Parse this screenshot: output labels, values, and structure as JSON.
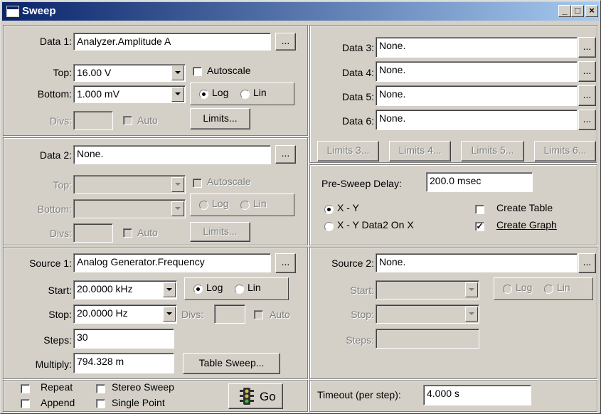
{
  "window": {
    "title": "Sweep",
    "min": "_",
    "max": "□",
    "close": "×"
  },
  "data1": {
    "label": "Data 1:",
    "value": "Analyzer.Amplitude A",
    "browse": "...",
    "top_label": "Top:",
    "top_value": "16.00   V",
    "autoscale": "Autoscale",
    "bottom_label": "Bottom:",
    "bottom_value": "1.000   mV",
    "log": "Log",
    "lin": "Lin",
    "divs_label": "Divs:",
    "auto": "Auto",
    "limits": "Limits..."
  },
  "data2": {
    "label": "Data 2:",
    "value": "None.",
    "browse": "...",
    "top_label": "Top:",
    "autoscale": "Autoscale",
    "bottom_label": "Bottom:",
    "log": "Log",
    "lin": "Lin",
    "divs_label": "Divs:",
    "auto": "Auto",
    "limits": "Limits..."
  },
  "data_right": [
    {
      "label": "Data 3:",
      "value": "None.",
      "browse": "..."
    },
    {
      "label": "Data 4:",
      "value": "None.",
      "browse": "..."
    },
    {
      "label": "Data 5:",
      "value": "None.",
      "browse": "..."
    },
    {
      "label": "Data 6:",
      "value": "None.",
      "browse": "..."
    }
  ],
  "limits_buttons": [
    "Limits 3...",
    "Limits 4...",
    "Limits 5...",
    "Limits 6..."
  ],
  "presweep": {
    "label": "Pre-Sweep Delay:",
    "value": "200.0   msec",
    "xy": "X - Y",
    "xy_data2": "X - Y  Data2 On X",
    "create_table": "Create Table",
    "create_graph": "Create Graph",
    "create_table_checked": false,
    "create_graph_checked": true
  },
  "source1": {
    "label": "Source 1:",
    "value": "Analog Generator.Frequency",
    "browse": "...",
    "start_label": "Start:",
    "start_value": "20.0000 kHz",
    "log": "Log",
    "lin": "Lin",
    "stop_label": "Stop:",
    "stop_value": "20.0000   Hz",
    "divs_label": "Divs:",
    "auto": "Auto",
    "steps_label": "Steps:",
    "steps_value": "30",
    "multiply_label": "Multiply:",
    "multiply_value": "794.328 m",
    "table_sweep": "Table Sweep..."
  },
  "source2": {
    "label": "Source 2:",
    "value": "None.",
    "browse": "...",
    "start_label": "Start:",
    "stop_label": "Stop:",
    "steps_label": "Steps:",
    "log": "Log",
    "lin": "Lin"
  },
  "options": {
    "repeat": "Repeat",
    "stereo_sweep": "Stereo Sweep",
    "append": "Append",
    "single_point": "Single Point",
    "go": "Go"
  },
  "timeout": {
    "label": "Timeout (per step):",
    "value": "4.000    s"
  },
  "check_mark": "✓"
}
